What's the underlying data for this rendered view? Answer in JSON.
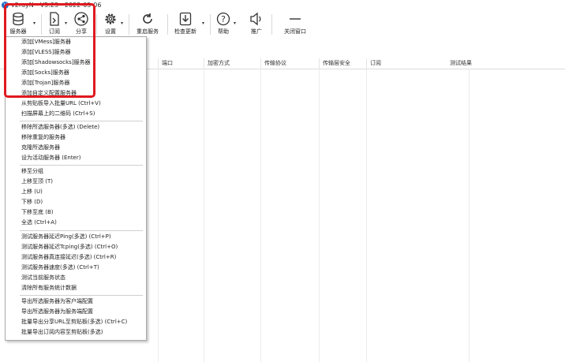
{
  "window": {
    "title": "v2rayN - V5.23 - 2022-05-06"
  },
  "toolbar": {
    "servers": "服务器",
    "subscribe": "订阅",
    "share": "分享",
    "settings": "设置",
    "reload": "重启服务",
    "check_update": "检查更新",
    "help": "帮助",
    "promote": "推广",
    "close_window": "关闭窗口"
  },
  "grid": {
    "columns": [
      "端口",
      "加密方式",
      "传输协议",
      "传输层安全",
      "订阅",
      "测试结果"
    ]
  },
  "menu": {
    "items": [
      "添加[VMess]服务器",
      "添加[VLESS]服务器",
      "添加[Shadowsocks]服务器",
      "添加[Socks]服务器",
      "添加[Trojan]服务器",
      "添加自定义配置服务器",
      "从剪贴板导入批量URL (Ctrl+V)",
      "扫描屏幕上的二维码 (Ctrl+S)",
      "移除所选服务器(多选) (Delete)",
      "移除重复的服务器",
      "克隆所选服务器",
      "设为活动服务器 (Enter)",
      "移至分组",
      "上移至顶 (T)",
      "上移 (U)",
      "下移 (D)",
      "下移至底 (B)",
      "全选 (Ctrl+A)",
      "测试服务器延迟Ping(多选) (Ctrl+P)",
      "测试服务器延迟Tcping(多选) (Ctrl+O)",
      "测试服务器真连接延迟(多选) (Ctrl+R)",
      "测试服务器速度(多选) (Ctrl+T)",
      "测试当前服务状态",
      "清除所有服务统计数据",
      "导出所选服务器为客户端配置",
      "导出所选服务器为服务端配置",
      "批量导出分享URL至剪贴板(多选) (Ctrl+C)",
      "批量导出订阅内容至剪贴板(多选)"
    ]
  },
  "colors": {
    "highlight_border": "#e0191f",
    "app_icon": "#1e6fc7"
  }
}
